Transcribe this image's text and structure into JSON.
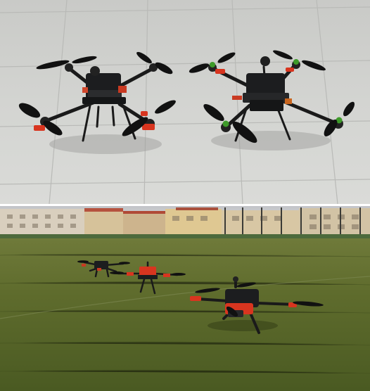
{
  "figure": {
    "panels": [
      {
        "subject": "two-quadcopters-on-concrete"
      },
      {
        "subject": "three-quadcopters-on-grass-field"
      }
    ]
  },
  "colors": {
    "concrete": "#cfd0cd",
    "concrete_light": "#dcdddb",
    "grass": "#5b6b2c",
    "grass_dark": "#3f4d1c",
    "sky": "#c9ccd0",
    "building": "#d8c7a4",
    "roof": "#b5523e",
    "drone_body": "#1c1d1f",
    "accent_red": "#d8351f",
    "accent_green": "#3e9b2a"
  }
}
